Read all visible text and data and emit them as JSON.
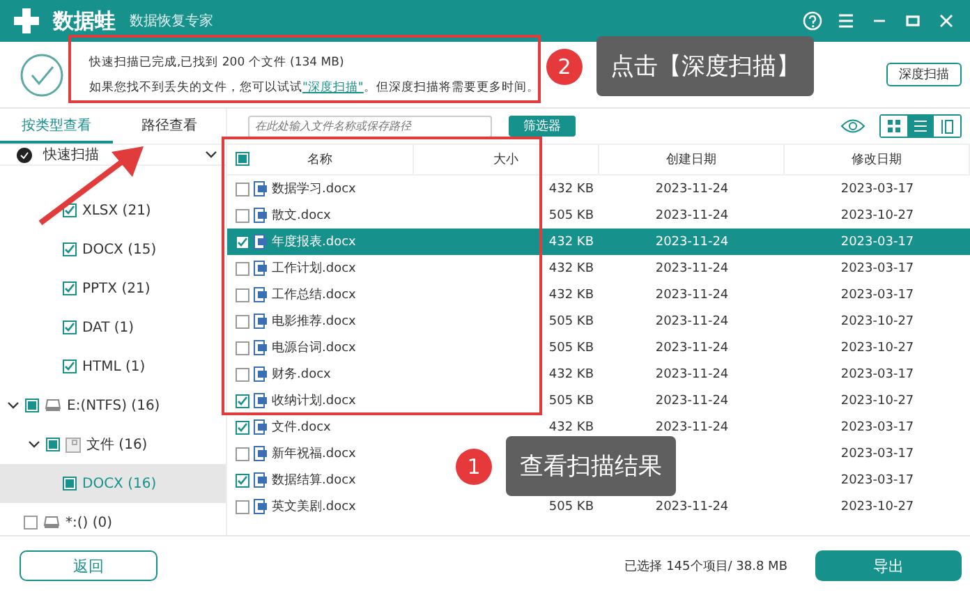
{
  "window": {
    "logo_text": "数据蛙",
    "subtitle": "数据恢复专家"
  },
  "scan_result": {
    "line_1": "快速扫描已完成,已找到 200 个文件 (134 MB)",
    "line_2_before": "如果您找不到丢失的文件，您可以试试",
    "link": "\"深度扫描\"",
    "line_2_after": "。但深度扫描将需要更多时间。",
    "deep_scan_button": "深度扫描"
  },
  "tabs": [
    {
      "label": "按类型查看",
      "selected": true
    },
    {
      "label": "路径查看",
      "selected": false
    }
  ],
  "search": {
    "placeholder": "在此处输入文件名称或保存路径"
  },
  "filter_button": "筛选器",
  "view_modes": [
    {
      "kind": "grid",
      "selected": false
    },
    {
      "kind": "list",
      "selected": true
    },
    {
      "kind": "detail",
      "selected": false
    }
  ],
  "tree": {
    "header": "快速扫描",
    "items": [
      {
        "label": "XLSX (21)",
        "kind": "type",
        "checked": true,
        "selected": false
      },
      {
        "label": "DOCX (15)",
        "kind": "type",
        "checked": true,
        "selected": false
      },
      {
        "label": "PPTX (21)",
        "kind": "type",
        "checked": true,
        "selected": false
      },
      {
        "label": "DAT (1)",
        "kind": "type",
        "checked": true,
        "selected": false
      },
      {
        "label": "HTML (1)",
        "kind": "type",
        "checked": true,
        "selected": false
      },
      {
        "label": "E:(NTFS) (16)",
        "kind": "drive",
        "checked": false,
        "partial": true,
        "selected": false,
        "expanded": true,
        "children": [
          {
            "label": "文件 (16)",
            "kind": "folder",
            "checked": false,
            "partial": true,
            "selected": false,
            "expanded": true,
            "children": [
              {
                "label": "DOCX (16)",
                "kind": "type",
                "checked": false,
                "partial": true,
                "selected": true
              }
            ]
          }
        ]
      },
      {
        "label": "*:() (0)",
        "kind": "drive",
        "checked": false,
        "partial": false,
        "selected": false
      }
    ]
  },
  "table": {
    "header_checked": false,
    "header_partial": true,
    "columns": [
      "名称",
      "大小",
      "创建日期",
      "修改日期"
    ],
    "rows": [
      {
        "name": "数据学习.docx",
        "size": "432 KB",
        "created": "2023-11-24",
        "modified": "2023-03-17",
        "checked": false,
        "selected": false
      },
      {
        "name": "散文.docx",
        "size": "505 KB",
        "created": "2023-11-24",
        "modified": "2023-10-27",
        "checked": false,
        "selected": false
      },
      {
        "name": "年度报表.docx",
        "size": "432 KB",
        "created": "2023-11-24",
        "modified": "2023-03-17",
        "checked": true,
        "selected": true
      },
      {
        "name": "工作计划.docx",
        "size": "432 KB",
        "created": "2023-11-24",
        "modified": "2023-03-17",
        "checked": false,
        "selected": false
      },
      {
        "name": "工作总结.docx",
        "size": "432 KB",
        "created": "2023-11-24",
        "modified": "2023-03-17",
        "checked": false,
        "selected": false
      },
      {
        "name": "电影推荐.docx",
        "size": "505 KB",
        "created": "2023-11-24",
        "modified": "2023-10-27",
        "checked": false,
        "selected": false
      },
      {
        "name": "电源台词.docx",
        "size": "505 KB",
        "created": "2023-11-24",
        "modified": "2023-10-27",
        "checked": false,
        "selected": false
      },
      {
        "name": "财务.docx",
        "size": "432 KB",
        "created": "2023-11-24",
        "modified": "2023-03-17",
        "checked": false,
        "selected": false
      },
      {
        "name": "收纳计划.docx",
        "size": "505 KB",
        "created": "2023-11-24",
        "modified": "2023-10-27",
        "checked": true,
        "selected": false
      },
      {
        "name": "文件.docx",
        "size": "432 KB",
        "created": "2023-11-24",
        "modified": "2023-03-17",
        "checked": true,
        "selected": false
      },
      {
        "name": "新年祝福.docx",
        "modified": "2023-03-17",
        "checked": false,
        "selected": false
      },
      {
        "name": "数据结算.docx",
        "modified": "2023-03-17",
        "checked": true,
        "selected": false
      },
      {
        "name": "英文美剧.docx",
        "size": "505 KB",
        "created": "2023-11-24",
        "modified": "2023-10-27",
        "checked": false,
        "selected": false
      }
    ]
  },
  "footer": {
    "back_button": "返回",
    "selection_summary": "已选择 145个项目/ 38.8 MB",
    "export_button": "导出"
  },
  "annotations": [
    {
      "number": "2",
      "text": "点击【深度扫描】"
    },
    {
      "number": "1",
      "text": "查看扫描结果"
    }
  ]
}
